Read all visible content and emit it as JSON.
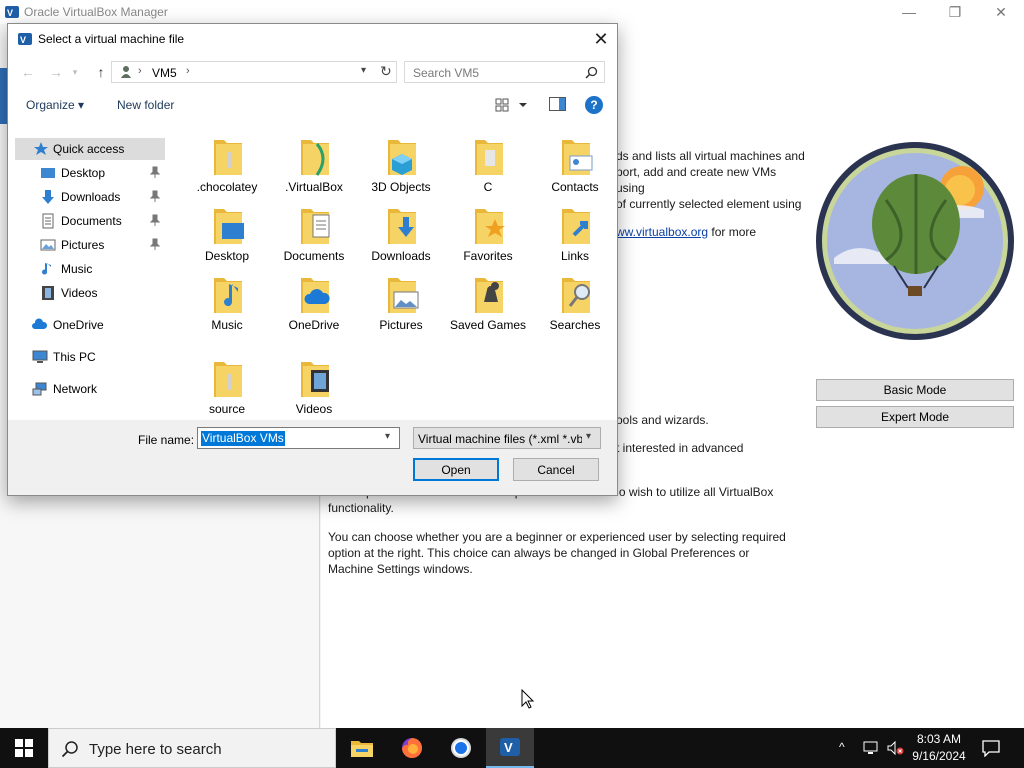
{
  "app": {
    "title": "Oracle VirtualBox Manager",
    "window_controls": {
      "minimize": "—",
      "maximize": "❐",
      "close": "✕"
    }
  },
  "welcome": {
    "p1": "ds and lists all virtual machines and port, add and create new VMs using of currently selected element using",
    "link_line_prefix": "",
    "link_text": "ww.virtualbox.org",
    "link_suffix": " for more",
    "p2": "ools and wizards.",
    "p3": "t interested in advanced",
    "p4": "The Expert Mode is intended for experienced users who wish to utilize all VirtualBox functionality.",
    "p5": "You can choose whether you are a beginner or experienced user by selecting required option at the right. This choice can always be changed in Global Preferences or Machine Settings windows.",
    "basic_mode_label": "Basic Mode",
    "expert_mode_label": "Expert Mode"
  },
  "dialog": {
    "title": "Select a virtual machine file",
    "close_glyph": "✕",
    "address": {
      "crumb": "VM5",
      "separator": "›"
    },
    "search_placeholder": "Search VM5",
    "organize_label": "Organize ▾",
    "new_folder_label": "New folder",
    "help_label": "?",
    "nav": {
      "quick_access": "Quick access",
      "desktop": "Desktop",
      "downloads": "Downloads",
      "documents": "Documents",
      "pictures": "Pictures",
      "music": "Music",
      "videos": "Videos",
      "onedrive": "OneDrive",
      "this_pc": "This PC",
      "network": "Network"
    },
    "items": [
      {
        "label": ".chocolatey",
        "icon": "folder-icon"
      },
      {
        "label": ".VirtualBox",
        "icon": "folder-icon"
      },
      {
        "label": "3D Objects",
        "icon": "3d-objects-folder-icon"
      },
      {
        "label": "C",
        "icon": "folder-icon"
      },
      {
        "label": "Contacts",
        "icon": "contacts-folder-icon"
      },
      {
        "label": "Desktop",
        "icon": "desktop-folder-icon"
      },
      {
        "label": "Documents",
        "icon": "documents-folder-icon"
      },
      {
        "label": "Downloads",
        "icon": "downloads-folder-icon"
      },
      {
        "label": "Favorites",
        "icon": "favorites-folder-icon"
      },
      {
        "label": "Links",
        "icon": "links-folder-icon"
      },
      {
        "label": "Music",
        "icon": "music-folder-icon"
      },
      {
        "label": "OneDrive",
        "icon": "onedrive-folder-icon"
      },
      {
        "label": "Pictures",
        "icon": "pictures-folder-icon"
      },
      {
        "label": "Saved Games",
        "icon": "saved-games-folder-icon"
      },
      {
        "label": "Searches",
        "icon": "searches-folder-icon"
      },
      {
        "label": "source",
        "icon": "folder-icon"
      },
      {
        "label": "Videos",
        "icon": "videos-folder-icon"
      }
    ],
    "filename_label": "File name:",
    "filename_value": "VirtualBox VMs",
    "filetype_value": "Virtual machine files (*.xml *.vbox)",
    "open_label": "Open",
    "cancel_label": "Cancel"
  },
  "taskbar": {
    "search_placeholder": "Type here to search",
    "apps": [
      "file-explorer",
      "firefox",
      "chrome",
      "virtualbox"
    ],
    "time": "8:03 AM",
    "date": "9/16/2024"
  },
  "colors": {
    "accent": "#0078d7",
    "folder": "#f4c543",
    "taskbar": "#101010",
    "link": "#0a41a5"
  }
}
